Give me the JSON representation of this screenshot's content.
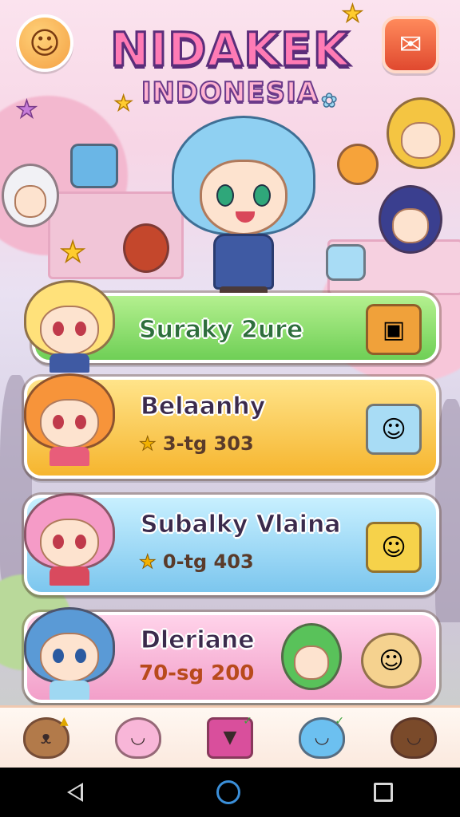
{
  "header": {
    "title": "NIDAKEK",
    "subtitle": "INDONESIA",
    "left_button_icon": "happy-face-icon",
    "right_button_icon": "chat-bubble-icon"
  },
  "cards": [
    {
      "name": "Suraky 2ure",
      "stat": "",
      "color": "#6fcf56",
      "item_icon": "treasure-chest-icon"
    },
    {
      "name": "Belaanhy",
      "stat": "3-tg 303",
      "color": "#f6b52e",
      "item_icon": "book-icon"
    },
    {
      "name": "Subalky Vlaina",
      "stat": "0-tg 403",
      "color": "#7cc6ee",
      "item_icon": "gift-box-icon"
    },
    {
      "name": "Dleriane",
      "stat": "70-sg 200",
      "color": "#f29fc9",
      "item_icon": "cookie-icon"
    }
  ],
  "bottom_nav": [
    {
      "icon": "bear-icon"
    },
    {
      "icon": "pink-blob-icon"
    },
    {
      "icon": "gift-icon"
    },
    {
      "icon": "blue-slime-icon"
    },
    {
      "icon": "boy-avatar-icon"
    }
  ],
  "colors": {
    "title_pink": "#ff7bb5",
    "outline_purple": "#5b2d7a",
    "nav_home": "#3b8fd9"
  }
}
